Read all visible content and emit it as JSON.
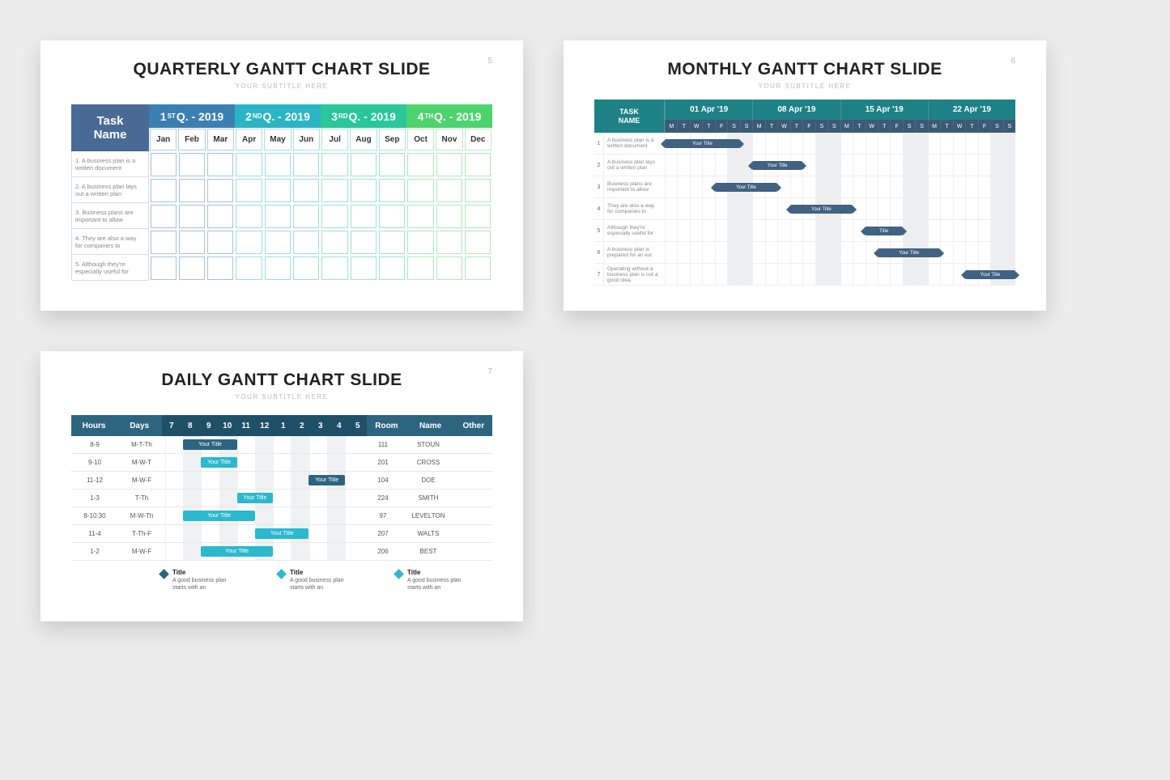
{
  "slide1": {
    "num": "5",
    "title": "QUARTERLY GANTT CHART SLIDE",
    "subtitle": "YOUR SUBTITLE HERE",
    "taskHead": [
      "Task",
      "Name"
    ],
    "quarters": [
      {
        "pre": "1",
        "sup": "ST",
        "rest": " Q. - 2019",
        "bg": "#3b7fb2"
      },
      {
        "pre": "2",
        "sup": "ND",
        "rest": " Q. - 2019",
        "bg": "#2bb5c4"
      },
      {
        "pre": "3",
        "sup": "RD",
        "rest": " Q. - 2019",
        "bg": "#29c79a"
      },
      {
        "pre": "4",
        "sup": "TH",
        "rest": " Q. - 2019",
        "bg": "#4dd36d"
      }
    ],
    "months": [
      "Jan",
      "Feb",
      "Mar",
      "Apr",
      "May",
      "Jun",
      "Jul",
      "Aug",
      "Sep",
      "Oct",
      "Nov",
      "Dec"
    ],
    "monthColors": [
      "#3b7fb2",
      "#3b7fb2",
      "#3b7fb2",
      "#2bb5c4",
      "#2bb5c4",
      "#2bb5c4",
      "#29c79a",
      "#29c79a",
      "#29c79a",
      "#4dd36d",
      "#4dd36d",
      "#4dd36d"
    ],
    "tasks": [
      "1. A business plan is a written document",
      "2. A business plan lays out a written plan",
      "3. Business plans are important to allow",
      "4. They are also a way for companies to",
      "5. Although they're especially useful for"
    ]
  },
  "slide2": {
    "num": "6",
    "title": "MONTHLY GANTT CHART SLIDE",
    "subtitle": "YOUR SUBTITLE HERE",
    "taskHead": [
      "TASK",
      "NAME"
    ],
    "weeks": [
      "01 Apr '19",
      "08 Apr '19",
      "15 Apr '19",
      "22 Apr '19"
    ],
    "dayLabels": [
      "M",
      "T",
      "W",
      "T",
      "F",
      "S",
      "S"
    ],
    "tasks": [
      "A business plan is a written document",
      "A business plan lays out a written plan",
      "Business plans are important to allow",
      "They are also a way for companies to",
      "Although they're especially useful for",
      "A business plan is prepared for an est.",
      "Operating without a business plan is not a good idea."
    ],
    "bars": [
      {
        "row": 0,
        "start": 0,
        "span": 6,
        "label": "Your Title"
      },
      {
        "row": 1,
        "start": 7,
        "span": 4,
        "label": "Your Title"
      },
      {
        "row": 2,
        "start": 4,
        "span": 5,
        "label": "Your Title"
      },
      {
        "row": 3,
        "start": 10,
        "span": 5,
        "label": "Your Title"
      },
      {
        "row": 4,
        "start": 16,
        "span": 3,
        "label": "Title"
      },
      {
        "row": 5,
        "start": 17,
        "span": 5,
        "label": "Your Title"
      },
      {
        "row": 6,
        "start": 24,
        "span": 4,
        "label": "Your Title"
      }
    ]
  },
  "slide3": {
    "num": "7",
    "title": "DAILY GANTT CHART SLIDE",
    "subtitle": "YOUR SUBTITLE HERE",
    "headers": {
      "hours": "Hours",
      "days": "Days",
      "room": "Room",
      "name": "Name",
      "other": "Other"
    },
    "hourCols": [
      "7",
      "8",
      "9",
      "10",
      "11",
      "12",
      "1",
      "2",
      "3",
      "4",
      "5"
    ],
    "rows": [
      {
        "hours": "8-9",
        "days": "M-T-Th",
        "room": "111",
        "name": "STOUN",
        "other": "",
        "bar": {
          "start": 1,
          "span": 3,
          "label": "Your Title",
          "color": "#2d6580"
        }
      },
      {
        "hours": "9-10",
        "days": "M-W-T",
        "room": "201",
        "name": "CROSS",
        "other": "",
        "bar": {
          "start": 2,
          "span": 2,
          "label": "Your Title",
          "color": "#2bb9cf"
        }
      },
      {
        "hours": "11-12",
        "days": "M-W-F",
        "room": "104",
        "name": "DOE",
        "other": "",
        "bar": {
          "start": 8,
          "span": 2,
          "label": "Your Title",
          "color": "#2d6580"
        }
      },
      {
        "hours": "1-3",
        "days": "T-Th",
        "room": "224",
        "name": "SMITH",
        "other": "",
        "bar": {
          "start": 4,
          "span": 2,
          "label": "Your Title",
          "color": "#2bb9cf"
        }
      },
      {
        "hours": "8-10:30",
        "days": "M-W-Th",
        "room": "97",
        "name": "LEVELTON",
        "other": "",
        "bar": {
          "start": 1,
          "span": 4,
          "label": "Your Title",
          "color": "#2bb9cf"
        }
      },
      {
        "hours": "11-4",
        "days": "T-Th-F",
        "room": "207",
        "name": "WALTS",
        "other": "",
        "bar": {
          "start": 5,
          "span": 3,
          "label": "Your Title",
          "color": "#2bb9cf"
        }
      },
      {
        "hours": "1-2",
        "days": "M-W-F",
        "room": "206",
        "name": "BEST",
        "other": "",
        "bar": {
          "start": 2,
          "span": 4,
          "label": "Your Title",
          "color": "#2bb9cf"
        }
      }
    ],
    "legend": [
      {
        "color": "#2d6580",
        "title": "Title",
        "desc": "A good business plan starts with an"
      },
      {
        "color": "#2bb9cf",
        "title": "Title",
        "desc": "A good business plan starts with an"
      },
      {
        "color": "#2bb9cf",
        "title": "Title",
        "desc": "A good business plan starts with an"
      }
    ]
  },
  "chart_data": [
    {
      "type": "table",
      "title": "QUARTERLY GANTT CHART SLIDE",
      "columns": [
        "Task",
        "Jan",
        "Feb",
        "Mar",
        "Apr",
        "May",
        "Jun",
        "Jul",
        "Aug",
        "Sep",
        "Oct",
        "Nov",
        "Dec"
      ],
      "rows": 5,
      "note": "Empty gantt grid — no bars filled"
    },
    {
      "type": "table",
      "title": "MONTHLY GANTT CHART SLIDE",
      "x": "days (28, M-S x4 weeks starting 01 Apr '19)",
      "series": [
        {
          "name": "Task 1",
          "start_day": 1,
          "end_day": 6
        },
        {
          "name": "Task 2",
          "start_day": 8,
          "end_day": 11
        },
        {
          "name": "Task 3",
          "start_day": 5,
          "end_day": 9
        },
        {
          "name": "Task 4",
          "start_day": 11,
          "end_day": 15
        },
        {
          "name": "Task 5",
          "start_day": 17,
          "end_day": 19
        },
        {
          "name": "Task 6",
          "start_day": 18,
          "end_day": 22
        },
        {
          "name": "Task 7",
          "start_day": 25,
          "end_day": 28
        }
      ]
    },
    {
      "type": "table",
      "title": "DAILY GANTT CHART SLIDE",
      "columns_hours": [
        7,
        8,
        9,
        10,
        11,
        12,
        1,
        2,
        3,
        4,
        5
      ],
      "rows": [
        {
          "hours": "8-9",
          "days": "M-T-Th",
          "room": 111,
          "name": "STOUN"
        },
        {
          "hours": "9-10",
          "days": "M-W-T",
          "room": 201,
          "name": "CROSS"
        },
        {
          "hours": "11-12",
          "days": "M-W-F",
          "room": 104,
          "name": "DOE"
        },
        {
          "hours": "1-3",
          "days": "T-Th",
          "room": 224,
          "name": "SMITH"
        },
        {
          "hours": "8-10:30",
          "days": "M-W-Th",
          "room": 97,
          "name": "LEVELTON"
        },
        {
          "hours": "11-4",
          "days": "T-Th-F",
          "room": 207,
          "name": "WALTS"
        },
        {
          "hours": "1-2",
          "days": "M-W-F",
          "room": 206,
          "name": "BEST"
        }
      ]
    }
  ]
}
